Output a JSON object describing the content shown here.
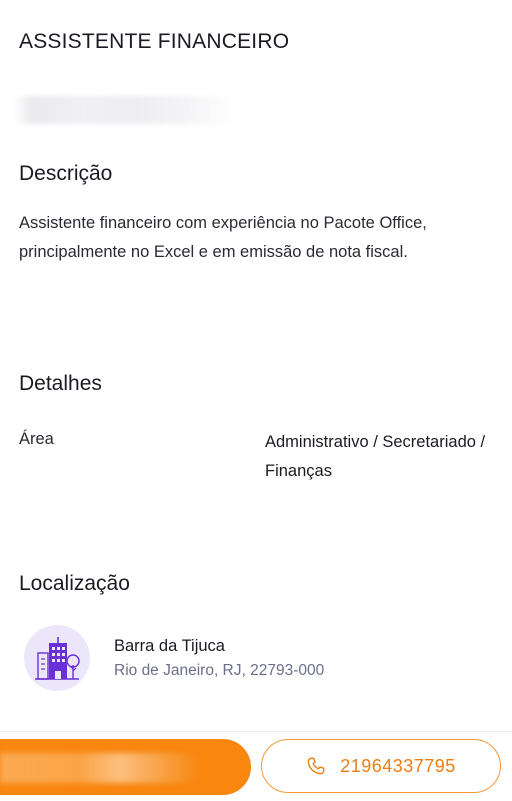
{
  "job": {
    "title": "ASSISTENTE FINANCEIRO"
  },
  "description": {
    "heading": "Descrição",
    "text": "Assistente financeiro com experiência no Pacote Office, principalmente no Excel e em emissão de nota fiscal."
  },
  "details": {
    "heading": "Detalhes",
    "area_label": "Área",
    "area_value": "Administrativo / Secretariado / Finanças"
  },
  "location": {
    "heading": "Localização",
    "icon": "city-buildings-icon",
    "name": "Barra da Tijuca",
    "address": "Rio de Janeiro, RJ, 22793-000"
  },
  "actions": {
    "phone_number": "21964337795",
    "phone_icon": "phone-icon"
  },
  "colors": {
    "accent": "#f8860f",
    "accent_text": "#ee7d10",
    "location_icon_bg": "#ece6fb",
    "location_icon_fg": "#6a2fd6",
    "muted_text": "#6b6f8a"
  }
}
